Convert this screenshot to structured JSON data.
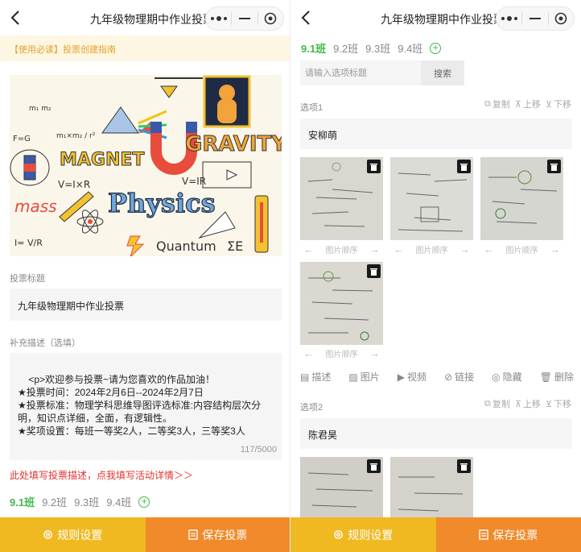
{
  "nav": {
    "title": "九年级物理期中作业投票"
  },
  "notice": "【使用必读】投票创建指南",
  "cover": {
    "words": [
      "MAGNET",
      "GRAVITY",
      "Physics",
      "mass",
      "Quantum",
      "V=I×R",
      "I=V/R",
      "F=G",
      "ΣE"
    ]
  },
  "form": {
    "title_label": "投票标题",
    "title_value": "九年级物理期中作业投票",
    "desc_label": "补充描述（选填）",
    "desc_value": "<p>欢迎参与投票~请为您喜欢的作品加油！\n★投票时间：2024年2月6日--2024年2月7日\n★投票标准：物理学科思维导图评选标准:内容结构层次分明，知识点详细，全面，有逻辑性。\n★奖项设置：每班一等奖2人，二等奖3人，三等奖3人",
    "desc_count": "117/5000",
    "red_link": "此处填写投票描述，点我填写活动详情＞＞"
  },
  "class_tabs": [
    "9.1班",
    "9.2班",
    "9.3班",
    "9.4班"
  ],
  "search": {
    "placeholder": "请输入选项标题",
    "button": "搜索"
  },
  "options": [
    {
      "label": "选项1",
      "name": "安柳萌"
    },
    {
      "label": "选项2",
      "name": "陈君昊"
    }
  ],
  "opt_actions": {
    "copy": "复制",
    "up": "上移",
    "down": "下移"
  },
  "image_order": "图片顺序",
  "toolbar": {
    "describe": "描述",
    "image": "图片",
    "video": "视频",
    "link": "链接",
    "hide": "隐藏",
    "delete": "删除"
  },
  "footer": {
    "rules": "规则设置",
    "save": "保存投票"
  },
  "colors": {
    "accent_green": "#42b848",
    "rules_yellow": "#f0b922",
    "save_orange": "#f08a2a",
    "alert_red": "#e5322d"
  }
}
